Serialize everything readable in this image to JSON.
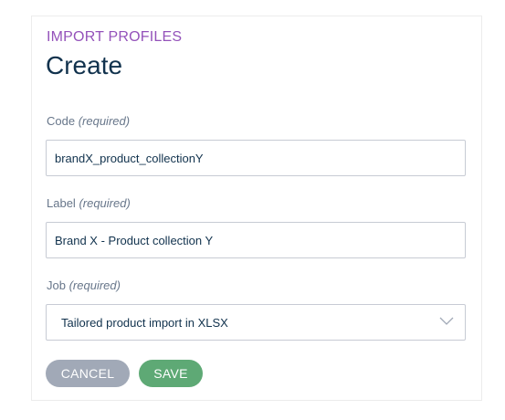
{
  "header": {
    "breadcrumb": "IMPORT PROFILES",
    "title": "Create"
  },
  "form": {
    "code": {
      "label": "Code",
      "required_note": "(required)",
      "value": "brandX_product_collectionY"
    },
    "label": {
      "label": "Label",
      "required_note": "(required)",
      "value": "Brand X - Product collection Y"
    },
    "job": {
      "label": "Job",
      "required_note": "(required)",
      "selected": "Tailored product import in XLSX"
    }
  },
  "actions": {
    "cancel_label": "CANCEL",
    "save_label": "SAVE"
  },
  "colors": {
    "breadcrumb": "#9452ba",
    "title": "#11324d",
    "cancel_button": "#a1a9b7",
    "save_button": "#5ea975"
  },
  "icons": {
    "select_arrow": "chevron-down-icon"
  }
}
